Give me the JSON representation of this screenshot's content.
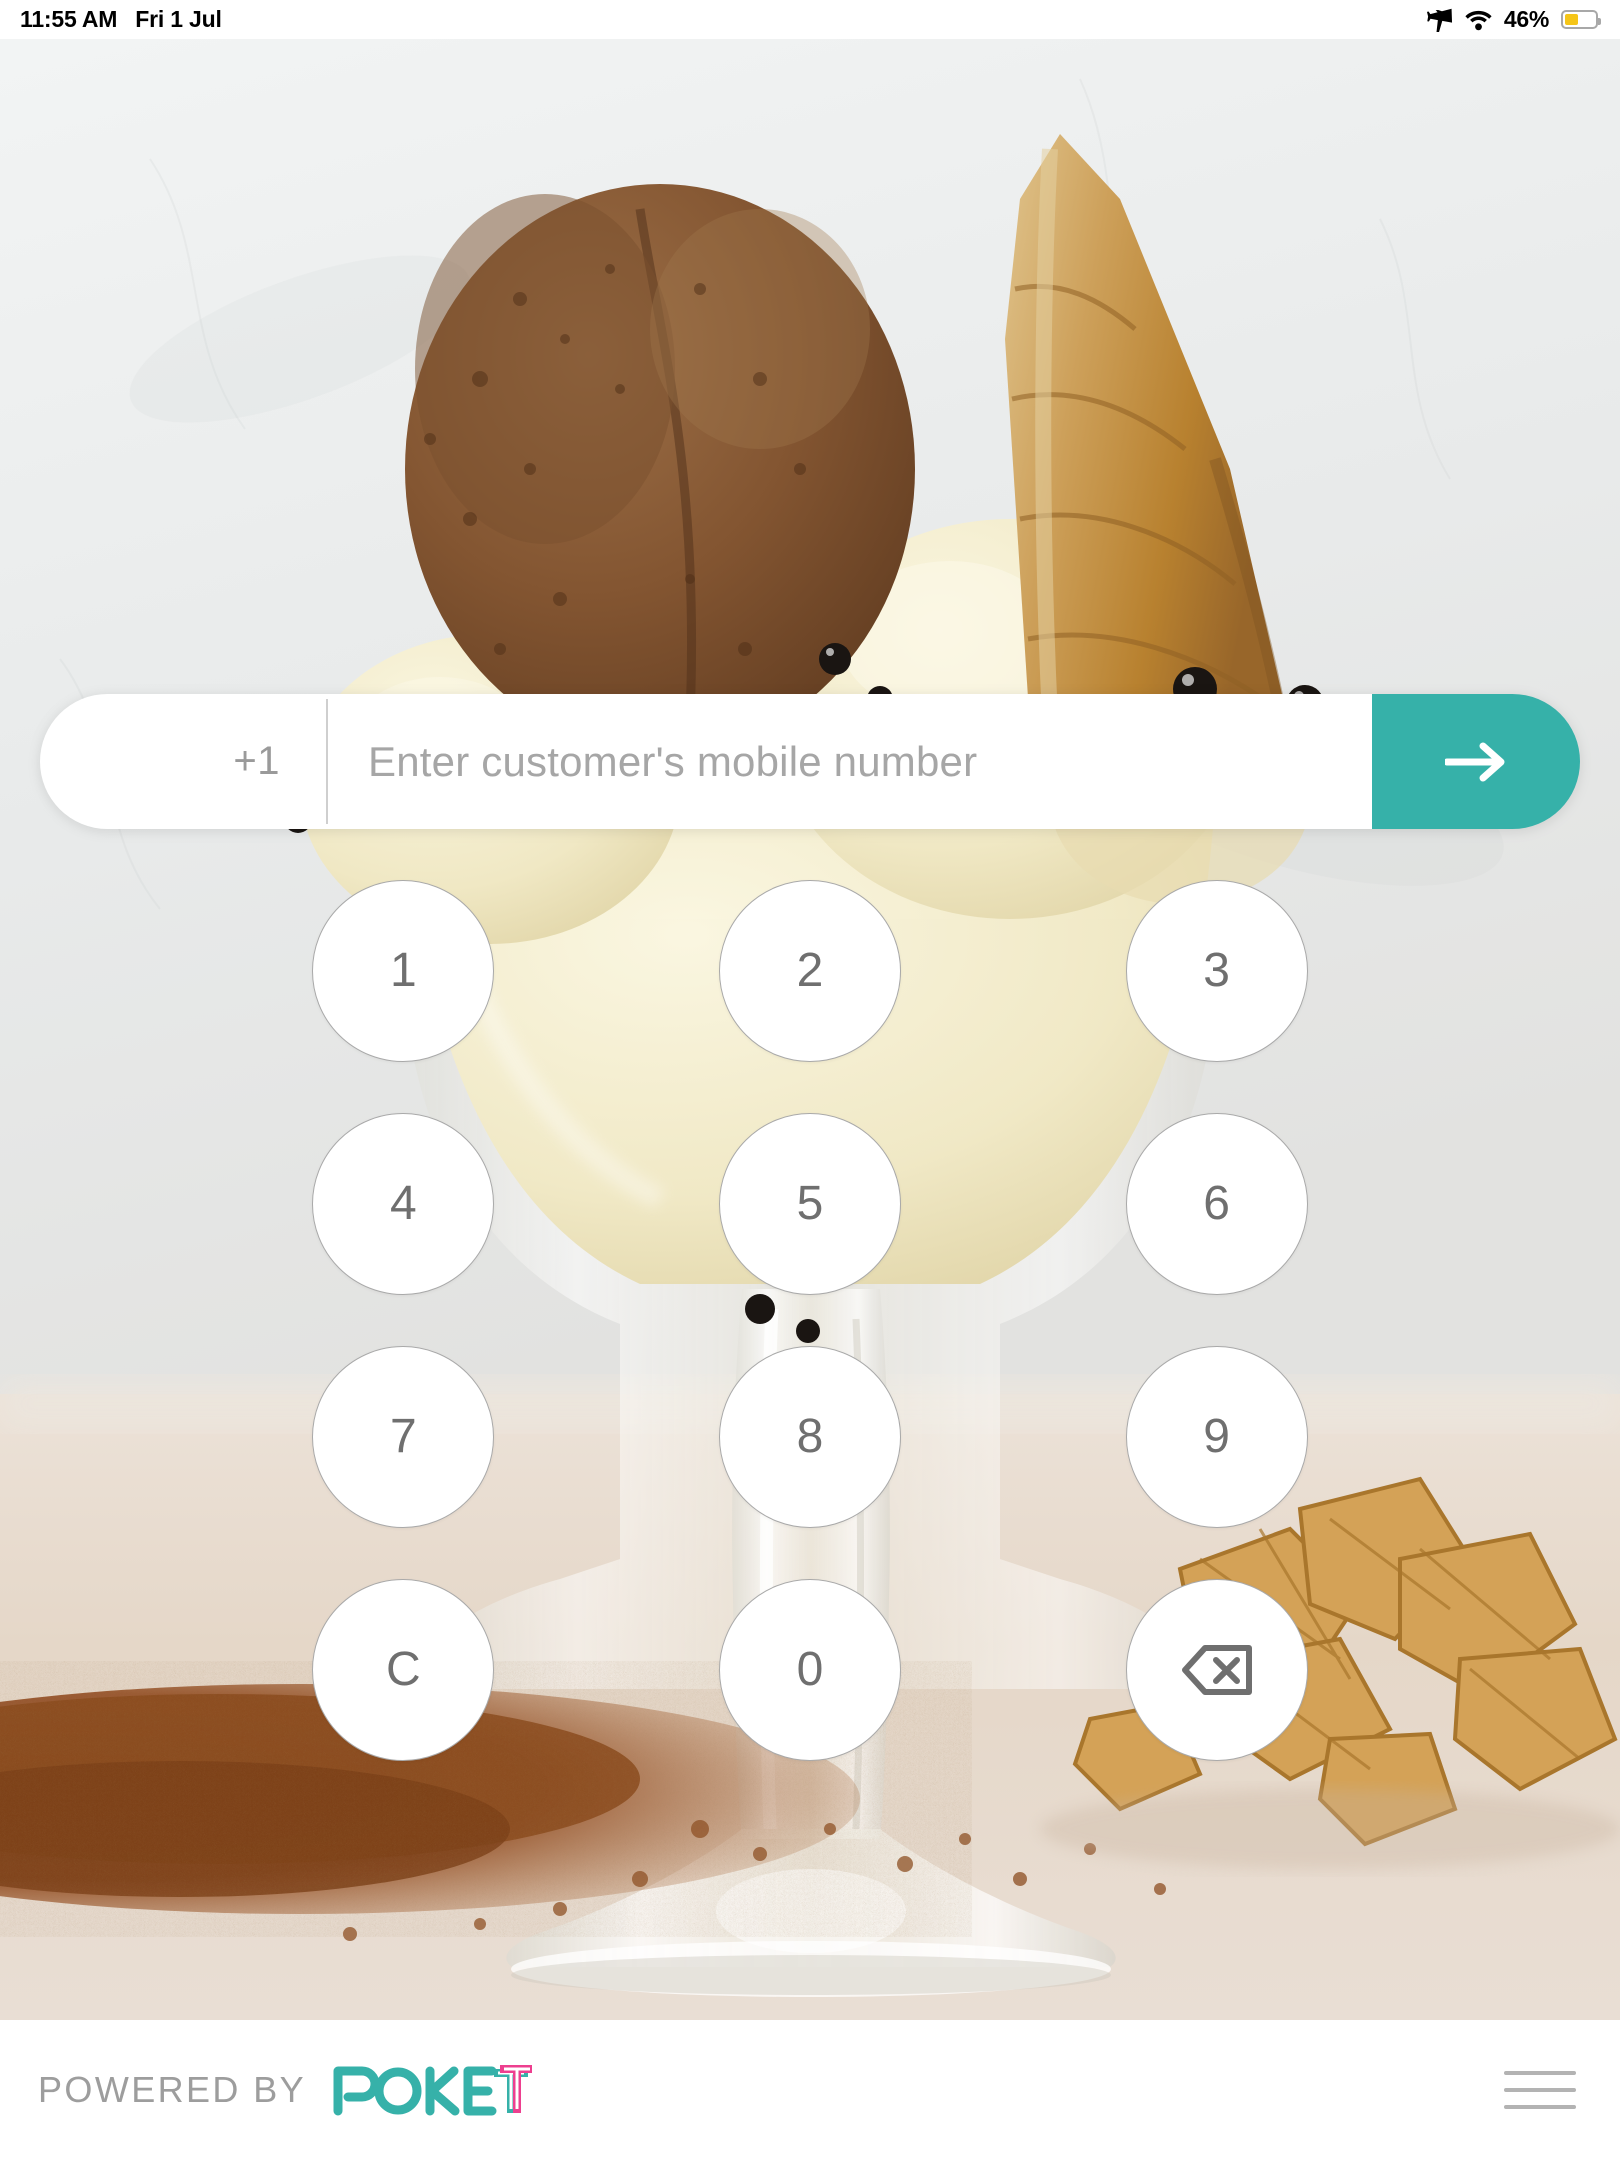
{
  "status_bar": {
    "time": "11:55 AM",
    "date": "Fri 1 Jul",
    "airplane_icon": "airplane-icon",
    "wifi_icon": "wifi-icon",
    "battery_percent": "46%",
    "battery_level": 46,
    "battery_color": "#f5c518"
  },
  "background": {
    "description": "Chocolate and vanilla ice cream scoops in a glass coupe with a waffle cone, cocoa powder and waffle pieces on a marble surface",
    "marble_color": "#eceeee",
    "chocolate_color": "#8a5f3c",
    "vanilla_color": "#f2eccf",
    "cone_color": "#c89445",
    "cocoa_color": "#8b4a20",
    "table_color": "#e7dbd0"
  },
  "entry": {
    "country_code": "+1",
    "placeholder": "Enter customer's mobile number",
    "value": "",
    "submit_icon": "arrow-right-icon",
    "submit_color": "#36b1a9"
  },
  "keypad": {
    "keys": [
      {
        "label": "1",
        "name": "key-1",
        "type": "digit"
      },
      {
        "label": "2",
        "name": "key-2",
        "type": "digit"
      },
      {
        "label": "3",
        "name": "key-3",
        "type": "digit"
      },
      {
        "label": "4",
        "name": "key-4",
        "type": "digit"
      },
      {
        "label": "5",
        "name": "key-5",
        "type": "digit"
      },
      {
        "label": "6",
        "name": "key-6",
        "type": "digit"
      },
      {
        "label": "7",
        "name": "key-7",
        "type": "digit"
      },
      {
        "label": "8",
        "name": "key-8",
        "type": "digit"
      },
      {
        "label": "9",
        "name": "key-9",
        "type": "digit"
      },
      {
        "label": "C",
        "name": "key-clear",
        "type": "clear"
      },
      {
        "label": "0",
        "name": "key-0",
        "type": "digit"
      },
      {
        "label": "",
        "name": "key-backspace",
        "type": "backspace",
        "icon": "backspace-icon"
      }
    ]
  },
  "footer": {
    "powered_by": "POWERED BY",
    "brand_name": "POKET",
    "brand_main": "POKE",
    "brand_accent_letter": "T",
    "brand_color": "#36b1a9",
    "brand_accent_color": "#ed3f8f",
    "menu_icon": "hamburger-menu-icon"
  }
}
